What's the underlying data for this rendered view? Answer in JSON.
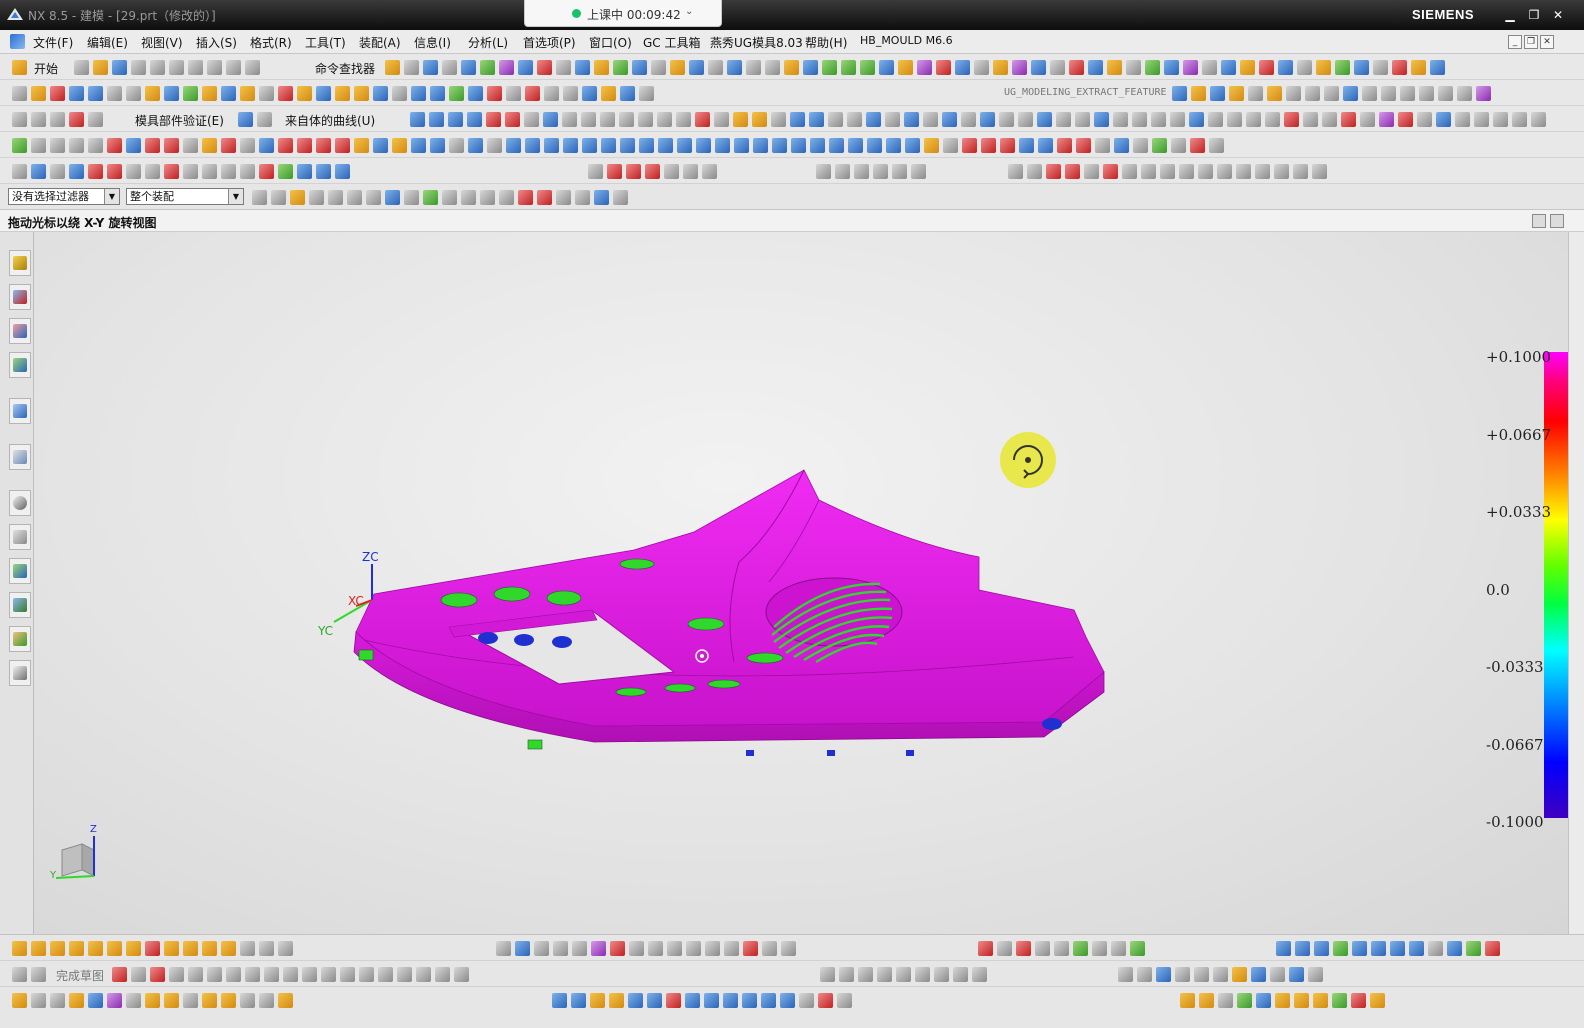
{
  "window": {
    "title": "NX 8.5 - 建模 - [29.prt（修改的）]",
    "brand": "SIEMENS",
    "recording_status": "上课中 00:09:42",
    "min_glyph": "▁",
    "max_glyph": "❐",
    "close_glyph": "✕"
  },
  "menu": {
    "items": [
      "文件(F)",
      "编辑(E)",
      "视图(V)",
      "插入(S)",
      "格式(R)",
      "工具(T)",
      "装配(A)",
      "信息(I)",
      "分析(L)",
      "首选项(P)",
      "窗口(O)",
      "GC 工具箱",
      "燕秀UG模具8.03",
      "帮助(H)",
      "HB_MOULD M6.6"
    ],
    "mdi_min": "_",
    "mdi_restore": "❐",
    "mdi_close": "✕"
  },
  "toolbar": {
    "start_label": "开始",
    "command_finder_label": "命令查找器",
    "extract_feature_label": "UG_MODELING_EXTRACT_FEATURE",
    "mold_validation_label": "模具部件验证(E)",
    "curve_from_body_label": "来自体的曲线(U)"
  },
  "selection_bar": {
    "filter_value": "没有选择过滤器",
    "scope_value": "整个装配"
  },
  "status": {
    "message": "拖动光标以绕 X-Y 旋转视图"
  },
  "viewport": {
    "legend_labels": [
      "+0.1000",
      "+0.0667",
      "+0.0333",
      "0.0",
      "-0.0333",
      "-0.0667",
      "-0.1000"
    ],
    "axis_labels": {
      "zc": "ZC",
      "xc": "XC",
      "yc": "YC"
    },
    "triad_labels": {
      "z": "Z",
      "y": "Y"
    },
    "model_color": "#e21be6",
    "analysis_green": "#2fd82a",
    "background": "#e6e6e6"
  },
  "bottom_toolbar": {
    "finish_sketch_label": "完成草图"
  }
}
